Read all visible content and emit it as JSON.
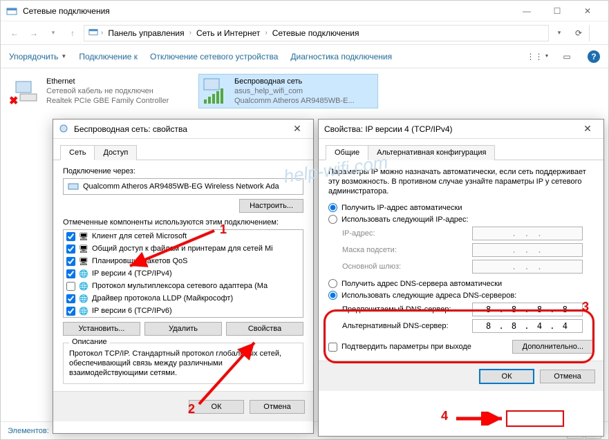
{
  "window": {
    "title": "Сетевые подключения",
    "breadcrumb": [
      "Панель управления",
      "Сеть и Интернет",
      "Сетевые подключения"
    ]
  },
  "commandbar": {
    "organize": "Упорядочить",
    "connect": "Подключение к",
    "disable": "Отключение сетевого устройства",
    "diagnose": "Диагностика подключения"
  },
  "networks": {
    "ethernet": {
      "name": "Ethernet",
      "status": "Сетевой кабель не подключен",
      "adapter": "Realtek PCIe GBE Family Controller"
    },
    "wifi": {
      "name": "Беспроводная сеть",
      "status": "asus_help_wifi_com",
      "adapter": "Qualcomm Atheros AR9485WB-E..."
    }
  },
  "statusbar": {
    "count": "Элементов:"
  },
  "props_dlg": {
    "title": "Беспроводная сеть: свойства",
    "tabs": {
      "net": "Сеть",
      "access": "Доступ"
    },
    "connect_via": "Подключение через:",
    "adapter": "Qualcomm Atheros AR9485WB-EG Wireless Network Ada",
    "configure": "Настроить...",
    "components_label": "Отмеченные компоненты используются этим подключением:",
    "components": [
      "Клиент для сетей Microsoft",
      "Общий доступ к файлам и принтерам для сетей Mi",
      "Планировщик пакетов QoS",
      "IP версии 4 (TCP/IPv4)",
      "Протокол мультиплексора сетевого адаптера (Ма",
      "Драйвер протокола LLDP (Майкрософт)",
      "IP версии 6 (TCP/IPv6)"
    ],
    "checks": [
      true,
      true,
      true,
      true,
      false,
      true,
      true
    ],
    "install": "Установить...",
    "uninstall": "Удалить",
    "properties": "Свойства",
    "desc_title": "Описание",
    "desc_text": "Протокол TCP/IP. Стандартный протокол глобальных сетей, обеспечивающий связь между различными взаимодействующими сетями.",
    "ok": "ОК",
    "cancel": "Отмена"
  },
  "ipv4_dlg": {
    "title": "Свойства: IP версии 4 (TCP/IPv4)",
    "tabs": {
      "general": "Общие",
      "alt": "Альтернативная конфигурация"
    },
    "info": "Параметры IP можно назначать автоматически, если сеть поддерживает эту возможность. В противном случае узнайте параметры IP у сетевого администратора.",
    "ip_auto": "Получить IP-адрес автоматически",
    "ip_manual": "Использовать следующий IP-адрес:",
    "ip_addr": "IP-адрес:",
    "mask": "Маска подсети:",
    "gateway": "Основной шлюз:",
    "dns_auto": "Получить адрес DNS-сервера автоматически",
    "dns_manual": "Использовать следующие адреса DNS-серверов:",
    "dns_pref": "Предпочитаемый DNS-сервер:",
    "dns_alt": "Альтернативный DNS-сервер:",
    "dns1": "8 . 8 . 8 . 8",
    "dns2": "8 . 8 . 4 . 4",
    "confirm": "Подтвердить параметры при выходе",
    "advanced": "Дополнительно...",
    "ok": "ОК",
    "cancel": "Отмена"
  },
  "annotations": {
    "n1": "1",
    "n2": "2",
    "n3": "3",
    "n4": "4"
  },
  "watermark": "help-wifi.com"
}
